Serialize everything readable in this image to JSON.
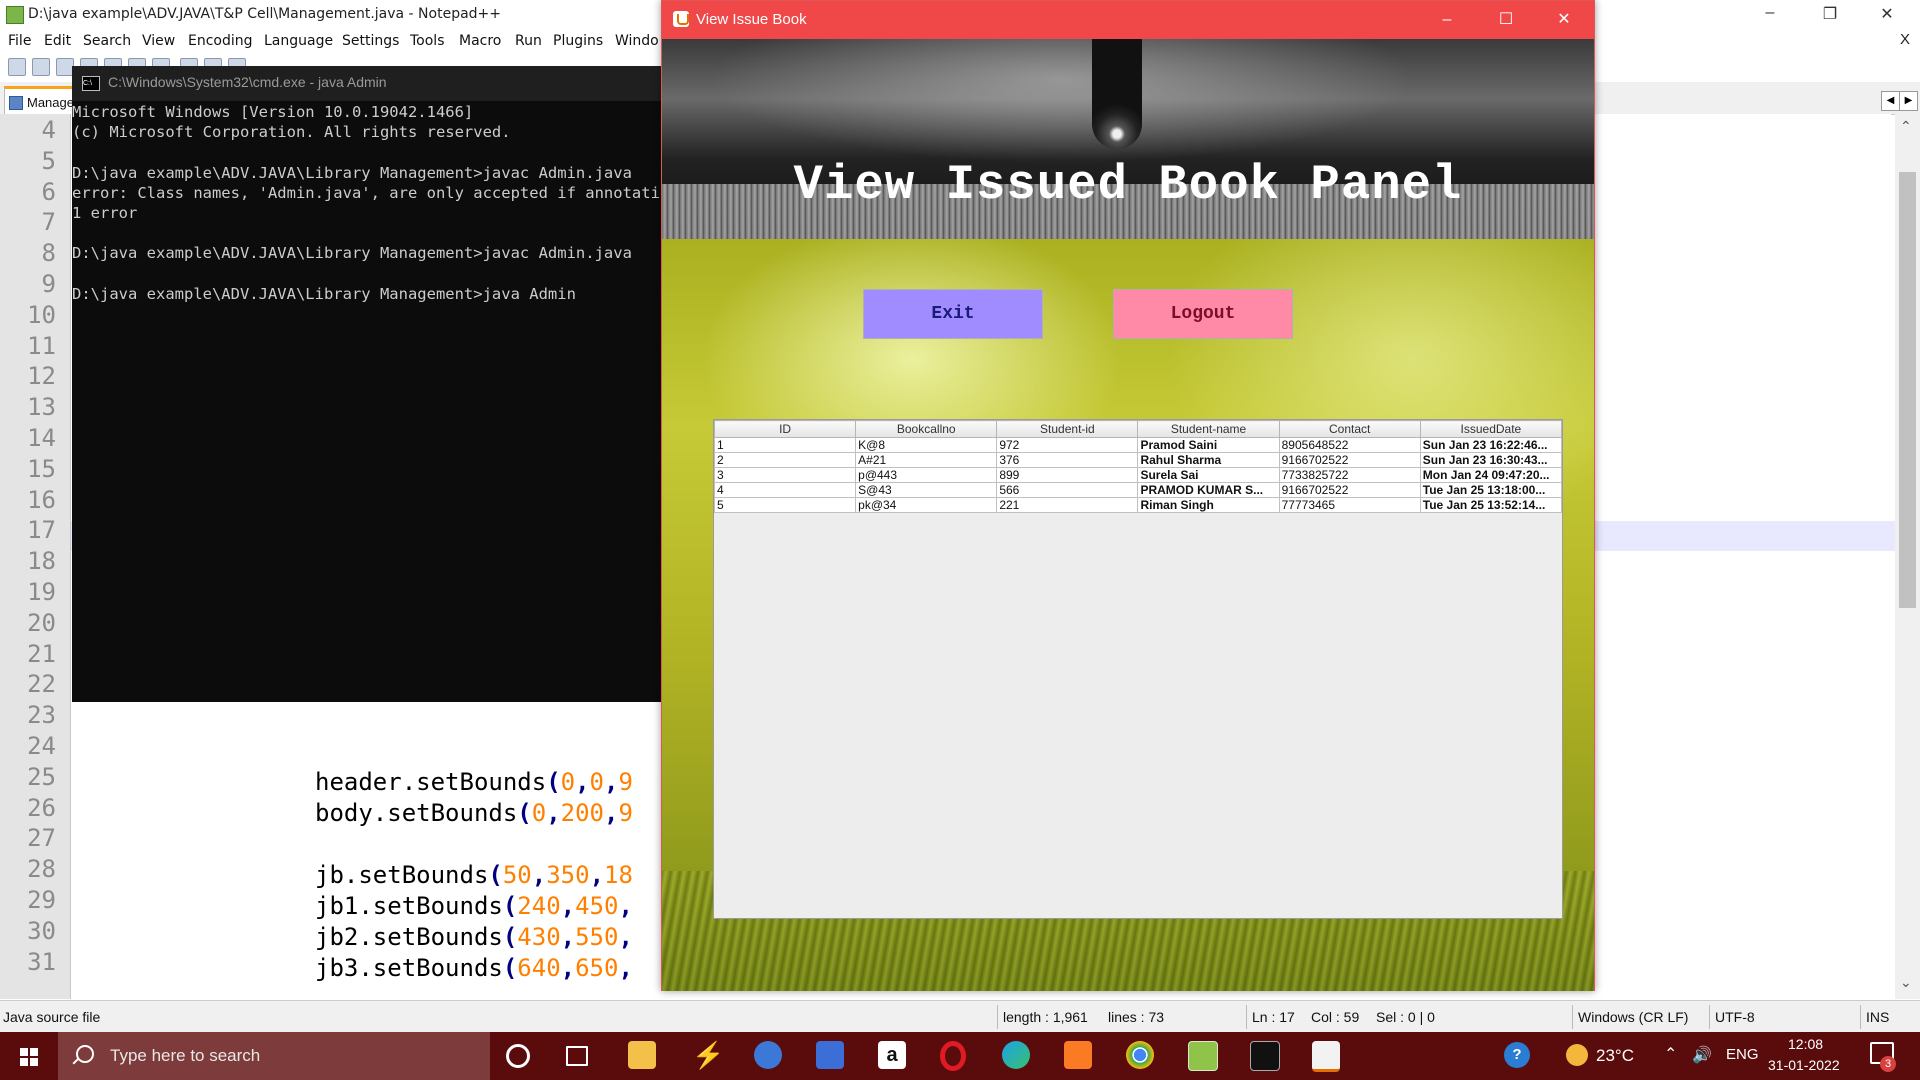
{
  "npp": {
    "title": "D:\\java example\\ADV.JAVA\\T&P Cell\\Management.java - Notepad++",
    "menu": [
      "File",
      "Edit",
      "Search",
      "View",
      "Encoding",
      "Language",
      "Settings",
      "Tools",
      "Macro",
      "Run",
      "Plugins",
      "Windo"
    ],
    "menu_close": "X",
    "tab_label": "Manage",
    "line_numbers": [
      "4",
      "5",
      "6",
      "7",
      "8",
      "9",
      "10",
      "11",
      "12",
      "13",
      "14",
      "15",
      "16",
      "17",
      "18",
      "19",
      "20",
      "21",
      "22",
      "23",
      "24",
      "25",
      "26",
      "27",
      "28",
      "29",
      "30",
      "31"
    ],
    "code_lines": [
      {
        "obj": "header.setBounds",
        "p": "(",
        "args": [
          [
            "0",
            ","
          ],
          [
            "0",
            ","
          ],
          [
            "9",
            ""
          ]
        ]
      },
      {
        "obj": "body.setBounds",
        "p": "(",
        "args": [
          [
            "0",
            ","
          ],
          [
            "200",
            ","
          ],
          [
            "9",
            ""
          ]
        ]
      },
      {
        "obj": "jb.setBounds",
        "p": "(",
        "args": [
          [
            "50",
            ","
          ],
          [
            "350",
            ","
          ],
          [
            "18",
            ""
          ]
        ]
      },
      {
        "obj": "jb1.setBounds",
        "p": "(",
        "args": [
          [
            "240",
            ","
          ],
          [
            "450",
            ","
          ]
        ]
      },
      {
        "obj": "jb2.setBounds",
        "p": "(",
        "args": [
          [
            "430",
            ","
          ],
          [
            "550",
            ","
          ]
        ]
      },
      {
        "obj": "jb3.setBounds",
        "p": "(",
        "args": [
          [
            "640",
            ","
          ],
          [
            "650",
            ","
          ]
        ]
      }
    ],
    "status": {
      "type": "Java source file",
      "length": "length : 1,961",
      "lines": "lines : 73",
      "ln": "Ln : 17",
      "col": "Col : 59",
      "sel": "Sel : 0 | 0",
      "eol": "Windows (CR LF)",
      "encoding": "UTF-8",
      "mode": "INS"
    }
  },
  "cmd": {
    "title": "C:\\Windows\\System32\\cmd.exe - java  Admin",
    "lines": [
      "Microsoft Windows [Version 10.0.19042.1466]",
      "(c) Microsoft Corporation. All rights reserved.",
      "",
      "D:\\java example\\ADV.JAVA\\Library Management>javac Admin.java",
      "error: Class names, 'Admin.java', are only accepted if annotation p",
      "1 error",
      "",
      "D:\\java example\\ADV.JAVA\\Library Management>javac Admin.java",
      "",
      "D:\\java example\\ADV.JAVA\\Library Management>java Admin"
    ]
  },
  "swing": {
    "title": "View Issue  Book",
    "heading": "View Issued Book Panel",
    "exit_label": "Exit",
    "logout_label": "Logout",
    "table": {
      "columns": [
        "ID",
        "Bookcallno",
        "Student-id",
        "Student-name",
        "Contact",
        "IssuedDate"
      ],
      "rows": [
        [
          "1",
          "K@8",
          "972",
          "Pramod Saini",
          "8905648522",
          "Sun Jan 23 16:22:46..."
        ],
        [
          "2",
          "A#21",
          "376",
          "Rahul Sharma",
          "9166702522",
          "Sun Jan 23 16:30:43..."
        ],
        [
          "3",
          "p@443",
          "899",
          "Surela Sai",
          "7733825722",
          "Mon Jan 24 09:47:20..."
        ],
        [
          "4",
          "S@43",
          "566",
          "PRAMOD KUMAR S...",
          "9166702522",
          "Tue Jan 25 13:18:00..."
        ],
        [
          "5",
          "pk@34",
          "221",
          "Riman Singh",
          "77773465",
          "Tue Jan 25 13:52:14..."
        ]
      ]
    }
  },
  "taskbar": {
    "search_placeholder": "Type here to search",
    "temperature": "23°C",
    "language": "ENG",
    "time": "12:08",
    "date": "31-01-2022",
    "notification_count": "3",
    "apps": [
      "cortana",
      "task-view",
      "file-explorer",
      "app-s",
      "chrome",
      "app-blue",
      "amazon",
      "opera",
      "edge",
      "xampp",
      "chrome",
      "notepadpp",
      "cmd",
      "java"
    ]
  }
}
